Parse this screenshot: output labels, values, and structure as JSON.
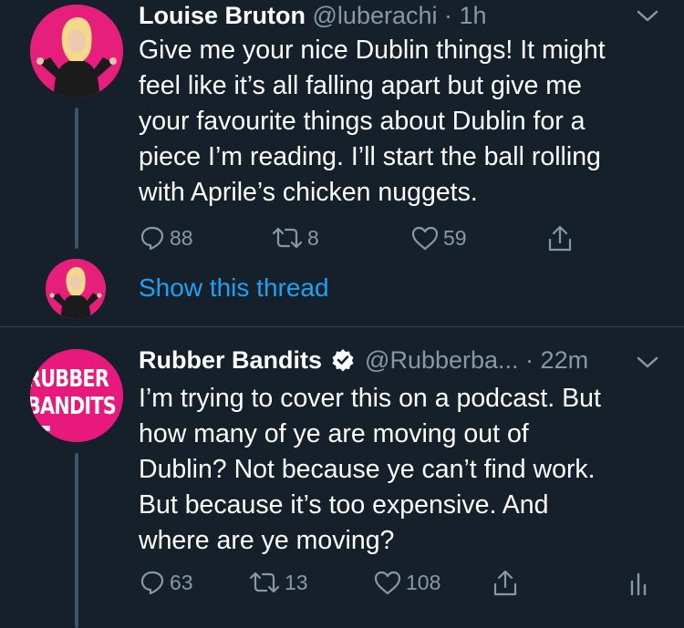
{
  "tweet1": {
    "name": "Louise Bruton",
    "handle": "@luberachi",
    "separator": " · ",
    "time": "1h",
    "lines": [
      "Give me your nice Dublin things! It might",
      "feel like it’s all falling apart but give me",
      "your favourite things about Dublin for a",
      "piece I’m reading. I’ll start the ball rolling",
      "with Aprile’s chicken nuggets."
    ],
    "replies": "88",
    "retweets": "8",
    "likes": "59"
  },
  "thread_link": {
    "label": "Show this thread"
  },
  "tweet2": {
    "name": "Rubber Bandits",
    "handle": "@Rubberba...",
    "separator": " · ",
    "time": "22m",
    "avatar_text": [
      "RUBBER",
      "BANDITS"
    ],
    "lines": [
      "I’m trying to cover this on a podcast. But",
      "how many of ye are moving out of",
      "Dublin? Not because ye can’t find work.",
      "But because it’s too expensive. And",
      "where are ye moving?"
    ],
    "replies": "63",
    "retweets": "13",
    "likes": "108"
  },
  "colors": {
    "background": "#15202b",
    "text": "#ffffff",
    "muted": "#8899a6",
    "link": "#1da1f2",
    "avatar_pink": "#e8197d"
  }
}
